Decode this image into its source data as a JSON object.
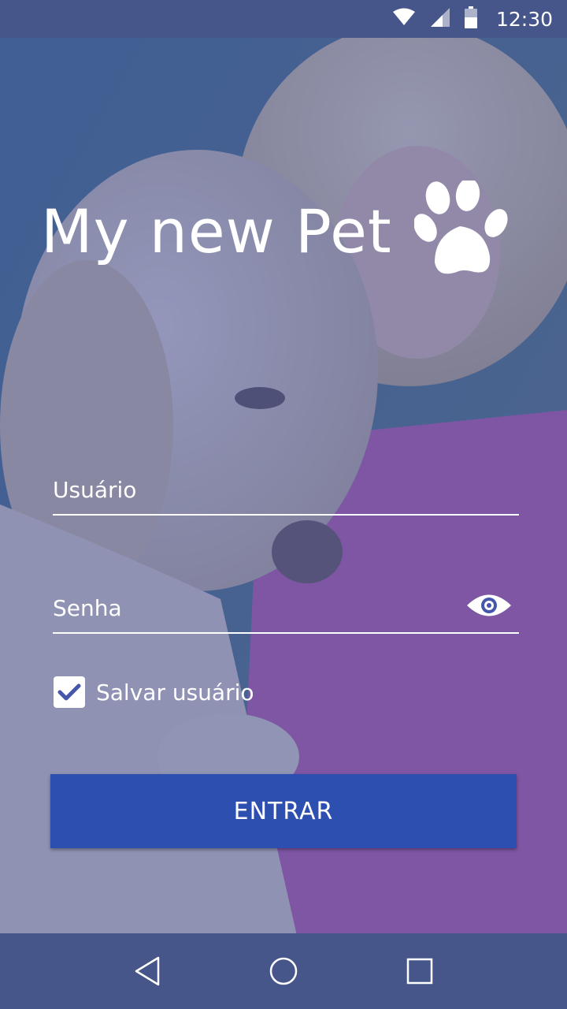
{
  "status_bar": {
    "time": "12:30",
    "icons": [
      "wifi-icon",
      "signal-icon",
      "battery-icon"
    ]
  },
  "app": {
    "title": "My new Pet",
    "logo_icon": "paw-icon"
  },
  "form": {
    "username_placeholder": "Usuário",
    "password_placeholder": "Senha",
    "show_password_icon": "eye-icon",
    "remember_label": "Salvar usuário",
    "remember_checked": true,
    "submit_label": "ENTRAR"
  },
  "nav_bar": {
    "buttons": [
      "back-icon",
      "home-icon",
      "recents-icon"
    ]
  },
  "colors": {
    "overlay": "#4656aa",
    "button": "#2c4fb0",
    "bar": "#46568a",
    "text": "#ffffff"
  }
}
